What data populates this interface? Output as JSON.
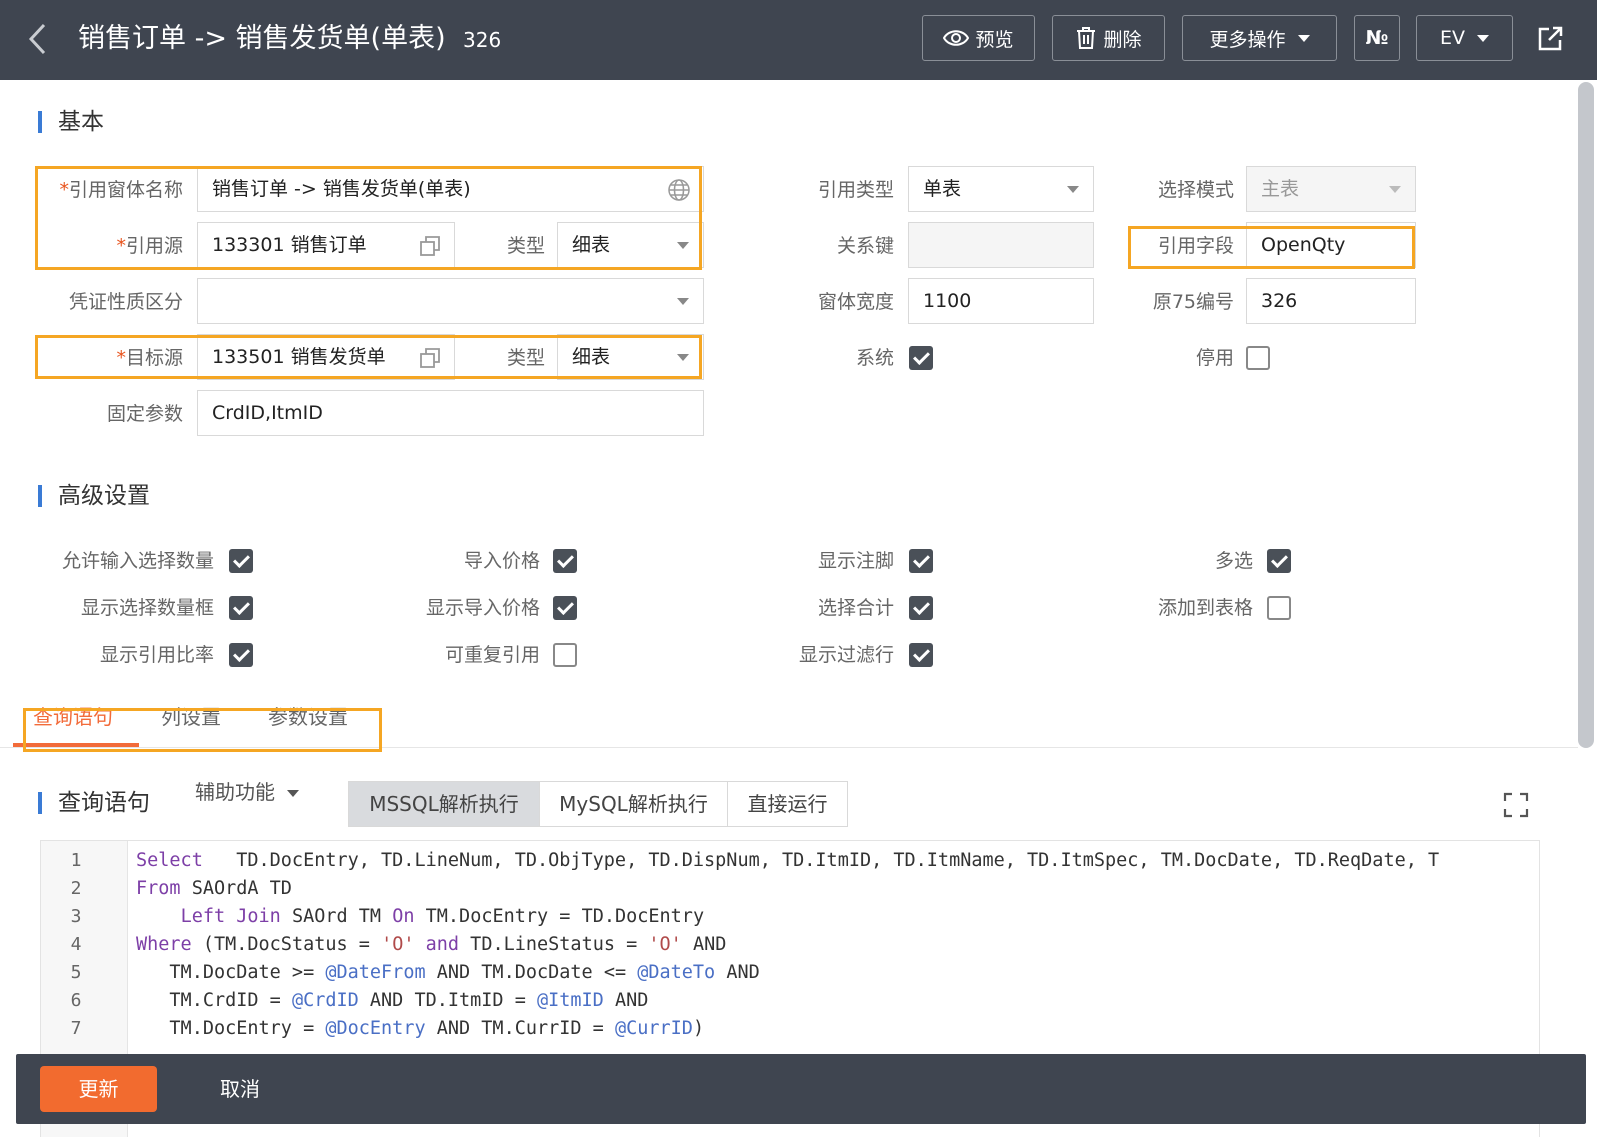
{
  "header": {
    "title": "销售订单 -> 销售发货单(单表)",
    "id": "326",
    "buttons": {
      "preview": "预览",
      "delete": "删除",
      "more": "更多操作",
      "numbering": "№",
      "env": "EV"
    }
  },
  "basic": {
    "section_title": "基本",
    "form_name": {
      "label": "引用窗体名称",
      "value": "销售订单 -> 销售发货单(单表)"
    },
    "source": {
      "label": "引用源",
      "value": "133301 销售订单",
      "type_label": "类型",
      "type_value": "细表"
    },
    "voucher": {
      "label": "凭证性质区分",
      "value": ""
    },
    "target": {
      "label": "目标源",
      "value": "133501 销售发货单",
      "type_label": "类型",
      "type_value": "细表"
    },
    "fixed_params": {
      "label": "固定参数",
      "value": "CrdID,ItmID"
    },
    "ref_type": {
      "label": "引用类型",
      "value": "单表"
    },
    "relation_key": {
      "label": "关系键",
      "value": ""
    },
    "form_width": {
      "label": "窗体宽度",
      "value": "1100"
    },
    "system": {
      "label": "系统",
      "checked": true
    },
    "select_mode": {
      "label": "选择模式",
      "value": "主表"
    },
    "ref_field": {
      "label": "引用字段",
      "value": "OpenQty"
    },
    "orig75": {
      "label": "原75编号",
      "value": "326"
    },
    "disabled": {
      "label": "停用",
      "checked": false
    }
  },
  "advanced": {
    "section_title": "高级设置",
    "options": [
      {
        "label": "允许输入选择数量",
        "checked": true
      },
      {
        "label": "显示选择数量框",
        "checked": true
      },
      {
        "label": "显示引用比率",
        "checked": true
      },
      {
        "label": "导入价格",
        "checked": true
      },
      {
        "label": "显示导入价格",
        "checked": true
      },
      {
        "label": "可重复引用",
        "checked": false
      },
      {
        "label": "显示注脚",
        "checked": true
      },
      {
        "label": "选择合计",
        "checked": true
      },
      {
        "label": "显示过滤行",
        "checked": true
      },
      {
        "label": "多选",
        "checked": true
      },
      {
        "label": "添加到表格",
        "checked": false
      }
    ]
  },
  "tabs": [
    {
      "label": "查询语句",
      "active": true
    },
    {
      "label": "列设置",
      "active": false
    },
    {
      "label": "参数设置",
      "active": false
    }
  ],
  "query": {
    "section_title": "查询语句",
    "aux_label": "辅助功能",
    "run_buttons": [
      "MSSQL解析执行",
      "MySQL解析执行",
      "直接运行"
    ],
    "active_run": "MSSQL解析执行",
    "line_numbers": [
      "1",
      "2",
      "3",
      "4",
      "5",
      "6",
      "7"
    ],
    "code": [
      "Select   TD.DocEntry, TD.LineNum, TD.ObjType, TD.DispNum, TD.ItmID, TD.ItmName, TD.ItmSpec, TM.DocDate, TD.ReqDate, T",
      "From SAOrdA TD",
      "    Left Join SAOrd TM On TM.DocEntry = TD.DocEntry",
      "Where (TM.DocStatus = 'O' and TD.LineStatus = 'O' AND",
      "   TM.DocDate >= @DateFrom AND TM.DocDate <= @DateTo AND",
      "   TM.CrdID = @CrdID AND TD.ItmID = @ItmID AND",
      "   TM.DocEntry = @DocEntry AND TM.CurrID = @CurrID)"
    ]
  },
  "footer": {
    "update": "更新",
    "cancel": "取消"
  },
  "colors": {
    "header_bg": "#3f4550",
    "accent_orange": "#f26b2f",
    "highlight_border": "#f5a623",
    "section_bar": "#3a7bd5",
    "checkbox_checked": "#4a5058"
  }
}
